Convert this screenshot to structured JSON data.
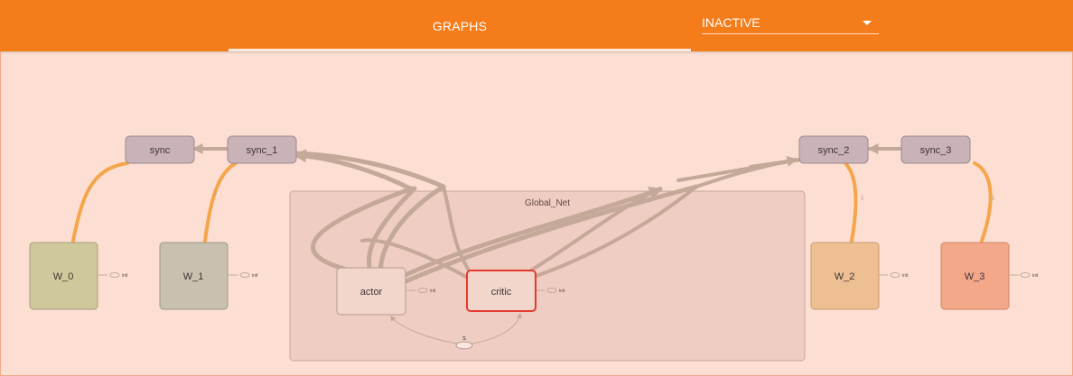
{
  "header": {
    "tab_label": "GRAPHS",
    "run_select_value": "INACTIVE"
  },
  "colors": {
    "header_bg": "#f57c1a",
    "canvas_bg": "#fcdfd2",
    "sync_fill": "#c9b3b8",
    "worker_0": "#cfc89a",
    "worker_1": "#c9c0b0",
    "worker_2": "#edbf92",
    "worker_3": "#f4a88a",
    "group_fill": "#f0cdc2",
    "selected_border": "#e53a2e",
    "edge_color": "#c4a898",
    "sync_edge": "#f5a54a"
  },
  "graph": {
    "nodes": {
      "sync": "sync",
      "sync_1": "sync_1",
      "sync_2": "sync_2",
      "sync_3": "sync_3",
      "w0": "W_0",
      "w1": "W_1",
      "w2": "W_2",
      "w3": "W_3",
      "global_net": "Global_Net",
      "actor": "actor",
      "critic": "critic",
      "s": "s"
    },
    "init_label": "init"
  }
}
